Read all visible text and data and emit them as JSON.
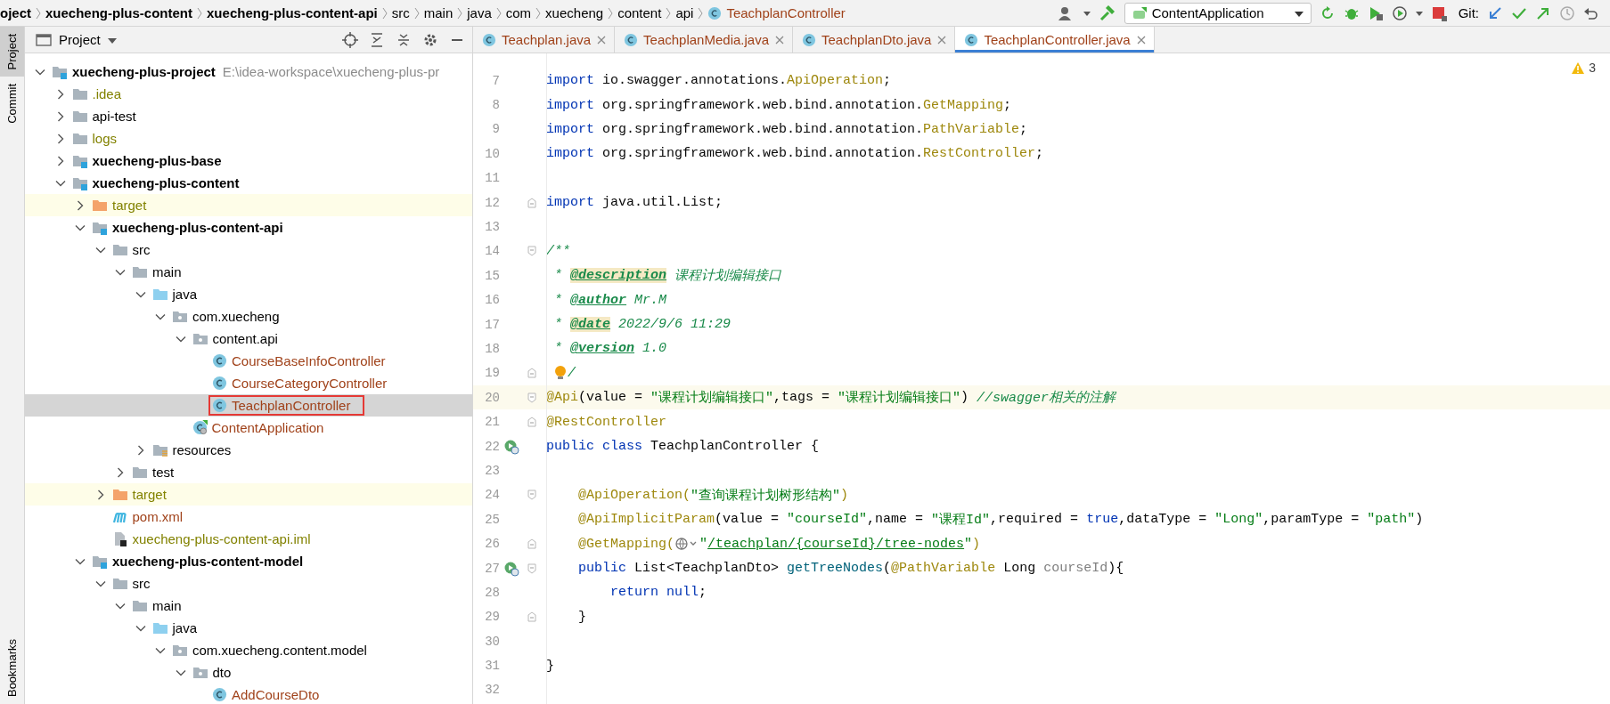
{
  "breadcrumbs": [
    {
      "label": "oject",
      "kind": "plain",
      "bold": true
    },
    {
      "label": "xuecheng-plus-content",
      "kind": "plain",
      "bold": true
    },
    {
      "label": "xuecheng-plus-content-api",
      "kind": "plain",
      "bold": true
    },
    {
      "label": "src",
      "kind": "plain",
      "bold": false
    },
    {
      "label": "main",
      "kind": "plain",
      "bold": false
    },
    {
      "label": "java",
      "kind": "plain",
      "bold": false
    },
    {
      "label": "com",
      "kind": "plain",
      "bold": false
    },
    {
      "label": "xuecheng",
      "kind": "plain",
      "bold": false
    },
    {
      "label": "content",
      "kind": "plain",
      "bold": false
    },
    {
      "label": "api",
      "kind": "plain",
      "bold": false
    },
    {
      "label": "TeachplanController",
      "kind": "class",
      "bold": false
    }
  ],
  "run_config": {
    "label": "ContentApplication"
  },
  "git": {
    "label": "Git:"
  },
  "side_strip": {
    "top": [
      {
        "label": "Project",
        "selected": true
      },
      {
        "label": "Commit",
        "selected": false
      }
    ],
    "bottom": [
      {
        "label": "Bookmarks",
        "selected": false
      }
    ]
  },
  "project_panel": {
    "title": "Project",
    "tree": [
      {
        "label": "xuecheng-plus-project",
        "hint": "E:\\idea-workspace\\xuecheng-plus-pr",
        "kind": "module",
        "color": "#000000",
        "expanded": true,
        "selected": false,
        "children": [
          {
            "label": ".idea",
            "kind": "folder",
            "color": "#828200",
            "expanded": false,
            "selected": false
          },
          {
            "label": "api-test",
            "kind": "folder",
            "color": "#000000",
            "expanded": false,
            "selected": false
          },
          {
            "label": "logs",
            "kind": "folder",
            "color": "#828200",
            "expanded": false,
            "selected": false
          },
          {
            "label": "xuecheng-plus-base",
            "kind": "module",
            "color": "#000000",
            "expanded": false,
            "selected": false
          },
          {
            "label": "xuecheng-plus-content",
            "kind": "module",
            "color": "#000000",
            "expanded": true,
            "selected": false,
            "children": [
              {
                "label": "target",
                "kind": "excluded",
                "color": "#828200",
                "expanded": false,
                "selected": false
              },
              {
                "label": "xuecheng-plus-content-api",
                "kind": "module",
                "color": "#000000",
                "expanded": true,
                "selected": false,
                "children": [
                  {
                    "label": "src",
                    "kind": "folder",
                    "color": "#000000",
                    "expanded": true,
                    "selected": false,
                    "children": [
                      {
                        "label": "main",
                        "kind": "folder",
                        "color": "#000000",
                        "expanded": true,
                        "selected": false,
                        "children": [
                          {
                            "label": "java",
                            "kind": "source-root",
                            "color": "#000000",
                            "expanded": true,
                            "selected": false,
                            "children": [
                              {
                                "label": "com.xuecheng",
                                "kind": "package",
                                "color": "#000000",
                                "expanded": true,
                                "selected": false,
                                "children": [
                                  {
                                    "label": "content.api",
                                    "kind": "package",
                                    "color": "#000000",
                                    "expanded": true,
                                    "selected": false,
                                    "children": [
                                      {
                                        "label": "CourseBaseInfoController",
                                        "kind": "class",
                                        "color": "#a0421a",
                                        "selected": false
                                      },
                                      {
                                        "label": "CourseCategoryController",
                                        "kind": "class",
                                        "color": "#a0421a",
                                        "selected": false
                                      },
                                      {
                                        "label": "TeachplanController",
                                        "kind": "class",
                                        "color": "#a0421a",
                                        "selected": true,
                                        "boxed": true
                                      }
                                    ]
                                  },
                                  {
                                    "label": "ContentApplication",
                                    "kind": "spring-app",
                                    "color": "#a0421a",
                                    "selected": false
                                  }
                                ]
                              }
                            ]
                          },
                          {
                            "label": "resources",
                            "kind": "resources",
                            "color": "#000000",
                            "expanded": false,
                            "selected": false
                          }
                        ]
                      },
                      {
                        "label": "test",
                        "kind": "folder",
                        "color": "#000000",
                        "expanded": false,
                        "selected": false
                      }
                    ]
                  },
                  {
                    "label": "target",
                    "kind": "excluded",
                    "color": "#828200",
                    "expanded": false,
                    "selected": false
                  },
                  {
                    "label": "pom.xml",
                    "kind": "maven",
                    "color": "#a0421a",
                    "selected": false
                  },
                  {
                    "label": "xuecheng-plus-content-api.iml",
                    "kind": "iml",
                    "color": "#828200",
                    "selected": false
                  }
                ]
              },
              {
                "label": "xuecheng-plus-content-model",
                "kind": "module",
                "color": "#000000",
                "expanded": true,
                "selected": false,
                "children": [
                  {
                    "label": "src",
                    "kind": "folder",
                    "color": "#000000",
                    "expanded": true,
                    "selected": false,
                    "children": [
                      {
                        "label": "main",
                        "kind": "folder",
                        "color": "#000000",
                        "expanded": true,
                        "selected": false,
                        "children": [
                          {
                            "label": "java",
                            "kind": "source-root",
                            "color": "#000000",
                            "expanded": true,
                            "selected": false,
                            "children": [
                              {
                                "label": "com.xuecheng.content.model",
                                "kind": "package",
                                "color": "#000000",
                                "expanded": true,
                                "selected": false,
                                "children": [
                                  {
                                    "label": "dto",
                                    "kind": "package",
                                    "color": "#000000",
                                    "expanded": true,
                                    "selected": false,
                                    "children": [
                                      {
                                        "label": "AddCourseDto",
                                        "kind": "class",
                                        "color": "#a0421a",
                                        "selected": false
                                      }
                                    ]
                                  }
                                ]
                              }
                            ]
                          }
                        ]
                      }
                    ]
                  }
                ]
              }
            ]
          }
        ]
      }
    ]
  },
  "tabs": [
    {
      "label": "Teachplan.java",
      "selected": false
    },
    {
      "label": "TeachplanMedia.java",
      "selected": false
    },
    {
      "label": "TeachplanDto.java",
      "selected": false
    },
    {
      "label": "TeachplanController.java",
      "selected": true
    }
  ],
  "editor": {
    "warnings": "3",
    "lines": [
      {
        "number": "7",
        "tokens": [
          {
            "kind": "kw",
            "text": "import"
          },
          {
            "kind": "plain",
            "text": " io.swagger.annotations."
          },
          {
            "kind": "ann",
            "text": "ApiOperation"
          },
          {
            "kind": "plain",
            "text": ";"
          }
        ]
      },
      {
        "number": "8",
        "tokens": [
          {
            "kind": "kw",
            "text": "import"
          },
          {
            "kind": "plain",
            "text": " org.springframework.web.bind.annotation."
          },
          {
            "kind": "ann",
            "text": "GetMapping"
          },
          {
            "kind": "plain",
            "text": ";"
          }
        ]
      },
      {
        "number": "9",
        "tokens": [
          {
            "kind": "kw",
            "text": "import"
          },
          {
            "kind": "plain",
            "text": " org.springframework.web.bind.annotation."
          },
          {
            "kind": "ann",
            "text": "PathVariable"
          },
          {
            "kind": "plain",
            "text": ";"
          }
        ]
      },
      {
        "number": "10",
        "tokens": [
          {
            "kind": "kw",
            "text": "import"
          },
          {
            "kind": "plain",
            "text": " org.springframework.web.bind.annotation."
          },
          {
            "kind": "ann",
            "text": "RestController"
          },
          {
            "kind": "plain",
            "text": ";"
          }
        ]
      },
      {
        "number": "11"
      },
      {
        "number": "12",
        "markers": [
          {
            "kind": "fold-end"
          }
        ],
        "tokens": [
          {
            "kind": "kw",
            "text": "import"
          },
          {
            "kind": "plain",
            "text": " java.util.List;"
          }
        ]
      },
      {
        "number": "13"
      },
      {
        "number": "14",
        "markers": [
          {
            "kind": "fold-start"
          }
        ],
        "tokens": [
          {
            "kind": "doc",
            "text": "/**"
          }
        ]
      },
      {
        "number": "15",
        "tokens": [
          {
            "kind": "doc",
            "text": " * "
          },
          {
            "kind": "doctag",
            "text": "@description"
          },
          {
            "kind": "doc",
            "text": " 课程计划编辑接口"
          }
        ]
      },
      {
        "number": "16",
        "tokens": [
          {
            "kind": "doc",
            "text": " * "
          },
          {
            "kind": "doctag-plain",
            "text": "@author"
          },
          {
            "kind": "doc",
            "text": " Mr.M"
          }
        ]
      },
      {
        "number": "17",
        "tokens": [
          {
            "kind": "doc",
            "text": " * "
          },
          {
            "kind": "doctag",
            "text": "@date"
          },
          {
            "kind": "doc",
            "text": " 2022/9/6 11:29"
          }
        ]
      },
      {
        "number": "18",
        "tokens": [
          {
            "kind": "doc",
            "text": " * "
          },
          {
            "kind": "doctag-plain",
            "text": "@version"
          },
          {
            "kind": "doc",
            "text": " 1.0"
          }
        ]
      },
      {
        "number": "19",
        "markers": [
          {
            "kind": "fold-end"
          }
        ],
        "tokens": [
          {
            "kind": "bulb"
          },
          {
            "kind": "doc",
            "text": "/"
          }
        ]
      },
      {
        "number": "20",
        "current": true,
        "markers": [
          {
            "kind": "fold-start"
          }
        ],
        "tokens": [
          {
            "kind": "ann",
            "text": "@Api"
          },
          {
            "kind": "plain",
            "text": "(value = "
          },
          {
            "kind": "str",
            "text": "\"课程计划编辑接口\""
          },
          {
            "kind": "plain",
            "text": ",tags = "
          },
          {
            "kind": "str",
            "text": "\"课程计划编辑接口\""
          },
          {
            "kind": "plain",
            "text": ") "
          },
          {
            "kind": "comment",
            "text": "//swagger相关的注解"
          }
        ]
      },
      {
        "number": "21",
        "markers": [
          {
            "kind": "fold-end"
          }
        ],
        "tokens": [
          {
            "kind": "ann",
            "text": "@RestController"
          }
        ]
      },
      {
        "number": "22",
        "markers": [
          {
            "kind": "run"
          }
        ],
        "tokens": [
          {
            "kind": "kw",
            "text": "public class "
          },
          {
            "kind": "plain",
            "text": "TeachplanController {"
          }
        ]
      },
      {
        "number": "23"
      },
      {
        "number": "24",
        "markers": [
          {
            "kind": "fold-start"
          }
        ],
        "tokens": [
          {
            "kind": "ann",
            "text": "    @ApiOperation("
          },
          {
            "kind": "str",
            "text": "\"查询课程计划树形结构\""
          },
          {
            "kind": "ann",
            "text": ")"
          }
        ]
      },
      {
        "number": "25",
        "tokens": [
          {
            "kind": "ann",
            "text": "    @ApiImplicitParam"
          },
          {
            "kind": "plain",
            "text": "(value = "
          },
          {
            "kind": "str",
            "text": "\"courseId\""
          },
          {
            "kind": "plain",
            "text": ",name = "
          },
          {
            "kind": "str",
            "text": "\"课程Id\""
          },
          {
            "kind": "plain",
            "text": ",required = "
          },
          {
            "kind": "kw",
            "text": "true"
          },
          {
            "kind": "plain",
            "text": ",dataType = "
          },
          {
            "kind": "str",
            "text": "\"Long\""
          },
          {
            "kind": "plain",
            "text": ",paramType = "
          },
          {
            "kind": "str",
            "text": "\"path\""
          },
          {
            "kind": "plain",
            "text": ")"
          }
        ]
      },
      {
        "number": "26",
        "markers": [
          {
            "kind": "fold-end"
          }
        ],
        "tokens": [
          {
            "kind": "ann",
            "text": "    @GetMapping("
          },
          {
            "kind": "url-icon"
          },
          {
            "kind": "str",
            "text": "\""
          },
          {
            "kind": "link",
            "text": "/teachplan/{courseId}/tree-nodes"
          },
          {
            "kind": "str",
            "text": "\""
          },
          {
            "kind": "ann",
            "text": ")"
          }
        ]
      },
      {
        "number": "27",
        "markers": [
          {
            "kind": "run"
          },
          {
            "kind": "fold-start"
          }
        ],
        "tokens": [
          {
            "kind": "kw",
            "text": "    public "
          },
          {
            "kind": "plain",
            "text": "List<TeachplanDto> "
          },
          {
            "kind": "method",
            "text": "getTreeNodes"
          },
          {
            "kind": "plain",
            "text": "("
          },
          {
            "kind": "ann",
            "text": "@PathVariable"
          },
          {
            "kind": "plain",
            "text": " Long "
          },
          {
            "kind": "param",
            "text": "courseId"
          },
          {
            "kind": "plain",
            "text": "){"
          }
        ]
      },
      {
        "number": "28",
        "tokens": [
          {
            "kind": "kw",
            "text": "        return null"
          },
          {
            "kind": "plain",
            "text": ";"
          }
        ]
      },
      {
        "number": "29",
        "markers": [
          {
            "kind": "fold-end"
          }
        ],
        "tokens": [
          {
            "kind": "plain",
            "text": "    }"
          }
        ]
      },
      {
        "number": "30"
      },
      {
        "number": "31",
        "tokens": [
          {
            "kind": "plain",
            "text": "}"
          }
        ]
      },
      {
        "number": "32"
      }
    ]
  }
}
